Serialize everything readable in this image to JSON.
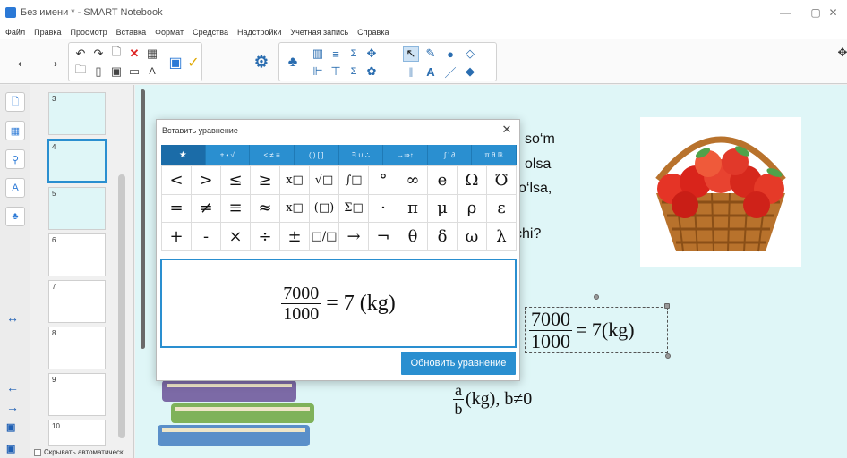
{
  "window": {
    "title": "Без имени * - SMART Notebook",
    "minimize": "—",
    "restore": "▢",
    "close": "✕"
  },
  "menu": [
    "Файл",
    "Правка",
    "Просмотр",
    "Вставка",
    "Формат",
    "Средства",
    "Надстройки",
    "Учетная запись",
    "Справка"
  ],
  "sorter": {
    "pages": [
      "3",
      "4",
      "5",
      "6",
      "7",
      "8",
      "9",
      "10"
    ],
    "autohide_label": "Скрывать автоматическ"
  },
  "canvas": {
    "text_fragments": [
      "so‘m",
      "olsa",
      "o‘lsa,",
      "chi?"
    ],
    "equation_object": {
      "numerator": "7000",
      "denominator": "1000",
      "rest": "= 7(kg)"
    },
    "formula2": {
      "numerator": "a",
      "denominator": "b",
      "rest": "(kg), b≠0"
    }
  },
  "dialog": {
    "title": "Вставить уравнение",
    "close": "✕",
    "tabs": [
      "★",
      "± • √",
      "< ≠ ≡",
      "( ) [ ]",
      "∃ ∪ ∴",
      "→⇒↕",
      "∫ ' ∂",
      "π θ ℝ"
    ],
    "symbols": [
      [
        "<",
        ">",
        "≤",
        "≥",
        "x□",
        "√□",
        "∫□",
        "°",
        "∞",
        "e",
        "Ω",
        "℧"
      ],
      [
        "=",
        "≠",
        "≡",
        "≈",
        "x□",
        "(□)",
        "Σ□",
        "·",
        "π",
        "μ",
        "ρ",
        "ε"
      ],
      [
        "+",
        "-",
        "×",
        "÷",
        "±",
        "□/□",
        "→",
        "¬",
        "θ",
        "δ",
        "ω",
        "λ"
      ]
    ],
    "editor": {
      "numerator": "7000",
      "denominator": "1000",
      "rest": "= 7 (kg)"
    },
    "update_button": "Обновить уравнение"
  }
}
